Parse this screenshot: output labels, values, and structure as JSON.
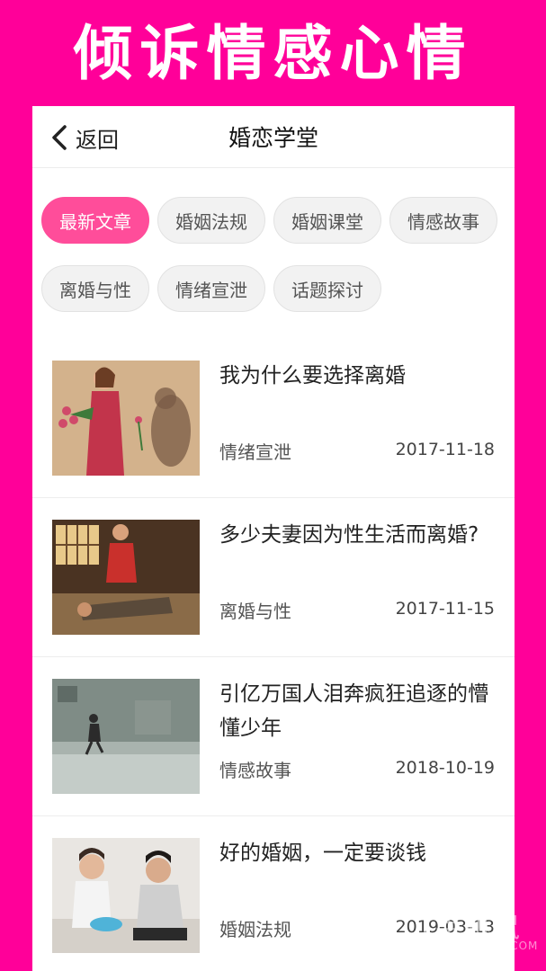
{
  "banner": {
    "title": "倾诉情感心情"
  },
  "header": {
    "back_label": "返回",
    "title": "婚恋学堂"
  },
  "tags": [
    {
      "label": "最新文章",
      "active": true
    },
    {
      "label": "婚姻法规",
      "active": false
    },
    {
      "label": "婚姻课堂",
      "active": false
    },
    {
      "label": "情感故事",
      "active": false
    },
    {
      "label": "离婚与性",
      "active": false
    },
    {
      "label": "情绪宣泄",
      "active": false
    },
    {
      "label": "话题探讨",
      "active": false
    }
  ],
  "articles": [
    {
      "title": "我为什么要选择离婚",
      "category": "情绪宣泄",
      "date": "2017-11-18"
    },
    {
      "title": "多少夫妻因为性生活而离婚?",
      "category": "离婚与性",
      "date": "2017-11-15"
    },
    {
      "title": "引亿万国人泪奔疯狂追逐的懵懂少年",
      "category": "情感故事",
      "date": "2018-10-19"
    },
    {
      "title": "好的婚姻，一定要谈钱",
      "category": "婚姻法规",
      "date": "2019-03-13"
    }
  ],
  "watermark": {
    "main": "手机鼠",
    "sub": "SHOUJISHU.COM"
  },
  "colors": {
    "background": "#ff0099",
    "accent": "#ff4d9a"
  }
}
